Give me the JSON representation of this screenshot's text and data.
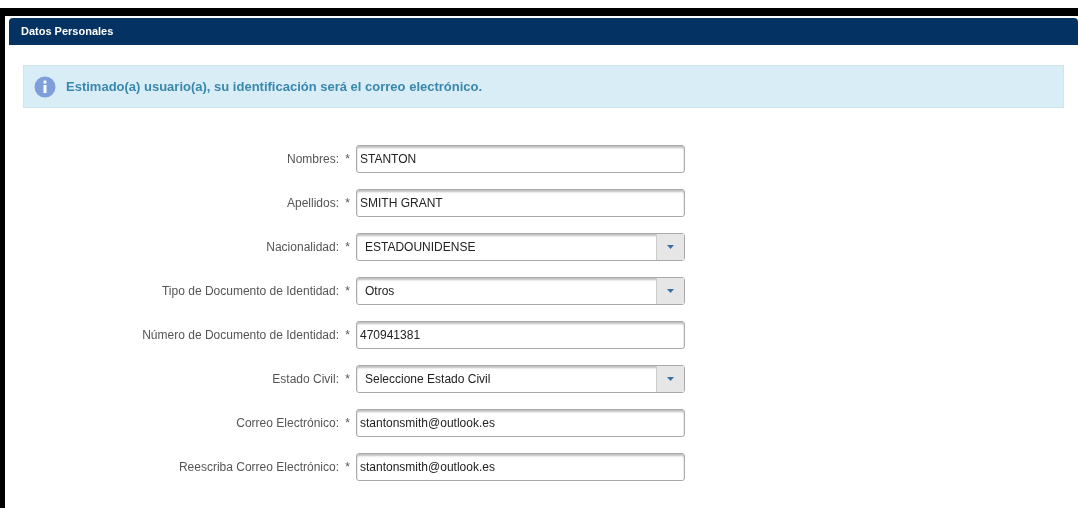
{
  "panel": {
    "title": "Datos Personales"
  },
  "alert": {
    "text": "Estimado(a) usuario(a), su identificación será el correo electrónico."
  },
  "fields": [
    {
      "label": "Nombres:",
      "required_mark": "*",
      "kind": "text",
      "value": "STANTON"
    },
    {
      "label": "Apellidos:",
      "required_mark": "*",
      "kind": "text",
      "value": "SMITH GRANT"
    },
    {
      "label": "Nacionalidad:",
      "required_mark": "*",
      "kind": "select",
      "value": "ESTADOUNIDENSE"
    },
    {
      "label": "Tipo de Documento de Identidad:",
      "required_mark": "*",
      "kind": "select",
      "value": "Otros"
    },
    {
      "label": "Número de Documento de Identidad:",
      "required_mark": "*",
      "kind": "text",
      "value": "470941381"
    },
    {
      "label": "Estado Civil:",
      "required_mark": "*",
      "kind": "select",
      "value": "Seleccione Estado Civil"
    },
    {
      "label": "Correo Electrónico:",
      "required_mark": "*",
      "kind": "text",
      "value": "stantonsmith@outlook.es"
    },
    {
      "label": "Reescriba Correo Electrónico:",
      "required_mark": "*",
      "kind": "text",
      "value": "stantonsmith@outlook.es"
    }
  ]
}
